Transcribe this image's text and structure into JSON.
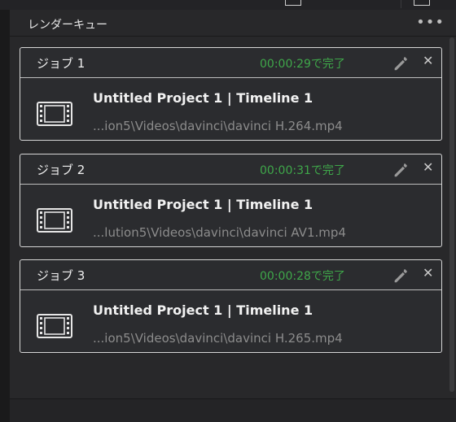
{
  "panel": {
    "title": "レンダーキュー",
    "options_icon": "more-options-icon"
  },
  "jobs": [
    {
      "name": "ジョブ 1",
      "status": "00:00:29で完了",
      "title": "Untitled Project 1 | Timeline 1",
      "path": "...ion5\\Videos\\davinci\\davinci H.264.mp4"
    },
    {
      "name": "ジョブ 2",
      "status": "00:00:31で完了",
      "title": "Untitled Project 1 | Timeline 1",
      "path": "...lution5\\Videos\\davinci\\davinci AV1.mp4"
    },
    {
      "name": "ジョブ 3",
      "status": "00:00:28で完了",
      "title": "Untitled Project 1 | Timeline 1",
      "path": "...ion5\\Videos\\davinci\\davinci H.265.mp4"
    }
  ],
  "colors": {
    "status_complete": "#3fa74a",
    "card_border": "#d6d6d6"
  }
}
